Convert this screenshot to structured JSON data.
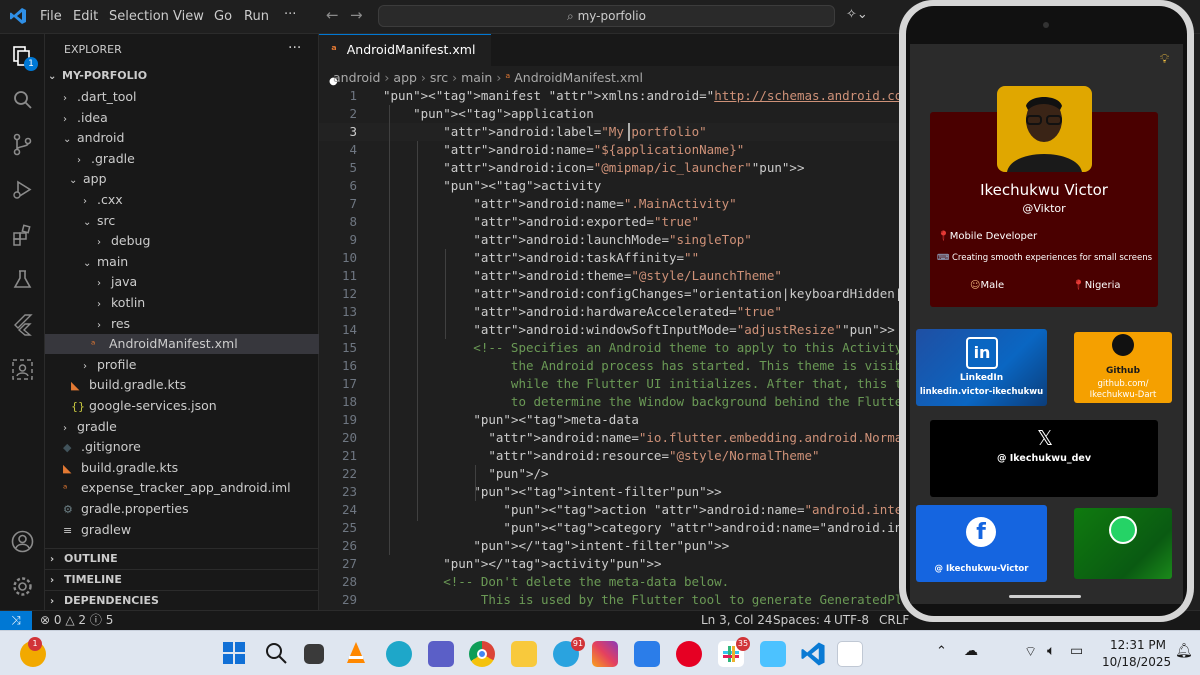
{
  "titlebar": {
    "menus": [
      "File",
      "Edit",
      "Selection",
      "View",
      "Go",
      "Run",
      "···"
    ],
    "search_text": "my-porfolio"
  },
  "activitybar": {
    "explorer_badge": "1"
  },
  "sidebar": {
    "header": "EXPLORER",
    "more": "···",
    "project": "MY-PORFOLIO",
    "items": [
      {
        "label": ".dart_tool",
        "chev": "›"
      },
      {
        "label": ".idea",
        "chev": "›"
      },
      {
        "label": "android",
        "chev": "⌄"
      },
      {
        "label": ".gradle",
        "chev": "›"
      },
      {
        "label": "app",
        "chev": "⌄"
      },
      {
        "label": ".cxx",
        "chev": "›"
      },
      {
        "label": "src",
        "chev": "⌄"
      },
      {
        "label": "debug",
        "chev": "›"
      },
      {
        "label": "main",
        "chev": "⌄"
      },
      {
        "label": "java",
        "chev": "›"
      },
      {
        "label": "kotlin",
        "chev": "›"
      },
      {
        "label": "res",
        "chev": "›"
      },
      {
        "label": "AndroidManifest.xml",
        "chev": ""
      },
      {
        "label": "profile",
        "chev": "›"
      },
      {
        "label": "build.gradle.kts",
        "chev": ""
      },
      {
        "label": "google-services.json",
        "chev": ""
      },
      {
        "label": "gradle",
        "chev": "›"
      },
      {
        "label": ".gitignore",
        "chev": ""
      },
      {
        "label": "build.gradle.kts",
        "chev": ""
      },
      {
        "label": "expense_tracker_app_android.iml",
        "chev": ""
      },
      {
        "label": "gradle.properties",
        "chev": ""
      },
      {
        "label": "gradlew",
        "chev": ""
      }
    ],
    "sections": [
      "OUTLINE",
      "TIMELINE",
      "DEPENDENCIES"
    ]
  },
  "editor": {
    "tab_label": "AndroidManifest.xml",
    "tab_dot": "●",
    "breadcrumb": [
      "android",
      "app",
      "src",
      "main",
      "AndroidManifest.xml"
    ],
    "lines": [
      {
        "n": "1",
        "t": "<manifest xmlns:android=\"http://schemas.android.com/apk/res/android\">"
      },
      {
        "n": "2",
        "t": "    <application"
      },
      {
        "n": "3",
        "t": "        android:label=\"My portfolio\""
      },
      {
        "n": "4",
        "t": "        android:name=\"${applicationName}\""
      },
      {
        "n": "5",
        "t": "        android:icon=\"@mipmap/ic_launcher\">"
      },
      {
        "n": "6",
        "t": "        <activity"
      },
      {
        "n": "7",
        "t": "            android:name=\".MainActivity\""
      },
      {
        "n": "8",
        "t": "            android:exported=\"true\""
      },
      {
        "n": "9",
        "t": "            android:launchMode=\"singleTop\""
      },
      {
        "n": "10",
        "t": "            android:taskAffinity=\"\""
      },
      {
        "n": "11",
        "t": "            android:theme=\"@style/LaunchTheme\""
      },
      {
        "n": "12",
        "t": "            android:configChanges=\"orientation|keyboardHidden|keyboard|s"
      },
      {
        "n": "13",
        "t": "            android:hardwareAccelerated=\"true\""
      },
      {
        "n": "14",
        "t": "            android:windowSoftInputMode=\"adjustResize\">"
      },
      {
        "n": "15",
        "t": "            <!-- Specifies an Android theme to apply to this Activity as"
      },
      {
        "n": "16",
        "t": "                 the Android process has started. This theme is visible"
      },
      {
        "n": "17",
        "t": "                 while the Flutter UI initializes. After that, this ther"
      },
      {
        "n": "18",
        "t": "                 to determine the Window background behind the Flutter U"
      },
      {
        "n": "19",
        "t": "            <meta-data"
      },
      {
        "n": "20",
        "t": "              android:name=\"io.flutter.embedding.android.NormalTheme\""
      },
      {
        "n": "21",
        "t": "              android:resource=\"@style/NormalTheme\""
      },
      {
        "n": "22",
        "t": "              />"
      },
      {
        "n": "23",
        "t": "            <intent-filter>"
      },
      {
        "n": "24",
        "t": "                <action android:name=\"android.intent.action.MAIN\"/>"
      },
      {
        "n": "25",
        "t": "                <category android:name=\"android.intent.category.LAUNCHER"
      },
      {
        "n": "26",
        "t": "            </intent-filter>"
      },
      {
        "n": "27",
        "t": "        </activity>"
      },
      {
        "n": "28",
        "t": "        <!-- Don't delete the meta-data below."
      },
      {
        "n": "29",
        "t": "             This is used by the Flutter tool to generate GeneratedPlugi"
      }
    ]
  },
  "statusbar": {
    "errors": "0",
    "warnings": "2",
    "info": "5",
    "position": "Ln 3, Col 24",
    "spaces": "Spaces: 4",
    "encoding": "UTF-8",
    "eol": "CRLF"
  },
  "taskbar": {
    "weather_badge": "1",
    "telegram_badge": "91",
    "slack_badge": "35",
    "time": "12:31 PM",
    "date": "10/18/2025"
  },
  "phone": {
    "name": "Ikechukwu Victor",
    "handle": "@Viktor",
    "role": "Mobile Developer",
    "tagline": "Creating smooth experiences for small screens",
    "gender": "Male",
    "country": "Nigeria",
    "linkedin": {
      "title": "LinkedIn",
      "link": "linkedin.victor-ikechukwu"
    },
    "github": {
      "title": "Github",
      "link": "github.com/ Ikechukwu-Dart"
    },
    "x_handle": "@ Ikechukwu_dev",
    "facebook_handle": "@ Ikechukwu-Victor",
    "colors": {
      "profile_card": "#4a0000",
      "linkedin": "#0a66c2",
      "github": "#f5a000",
      "x": "#000000",
      "facebook": "#1565e0",
      "whatsapp": "#0f7a0f"
    }
  }
}
